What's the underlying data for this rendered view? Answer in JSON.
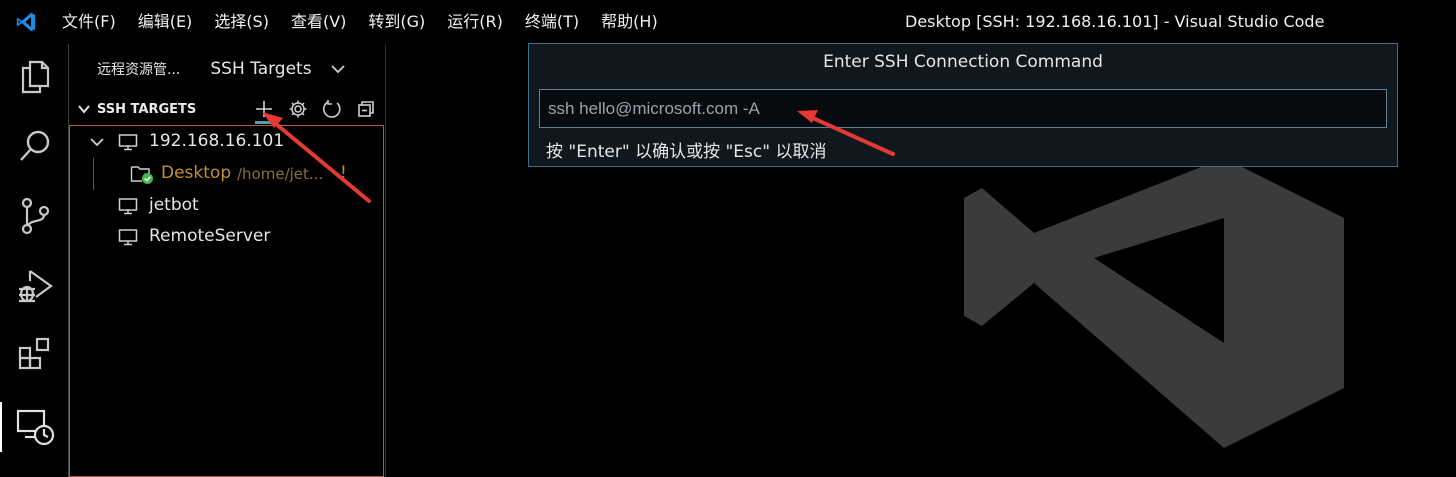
{
  "menu": [
    "文件(F)",
    "编辑(E)",
    "选择(S)",
    "查看(V)",
    "转到(G)",
    "运行(R)",
    "终端(T)",
    "帮助(H)"
  ],
  "window_title": "Desktop [SSH: 192.168.16.101] - Visual Studio Code",
  "activity_bar": {
    "icons": [
      "explorer-icon",
      "search-icon",
      "source-control-icon",
      "run-debug-icon",
      "extensions-icon",
      "remote-explorer-icon"
    ],
    "active": "remote-explorer-icon"
  },
  "sidebar": {
    "title": "远程资源管...",
    "dropdown_value": "SSH Targets",
    "section_title": "SSH TARGETS",
    "section_actions": [
      "add-icon",
      "gear-icon",
      "refresh-icon",
      "collapse-all-icon"
    ],
    "tree": {
      "host_expanded": "192.168.16.101",
      "folder_label": "Desktop",
      "folder_path": "/home/jet...",
      "folder_marker": "!",
      "hosts": [
        "jetbot",
        "RemoteServer"
      ]
    }
  },
  "quick_input": {
    "title": "Enter SSH Connection Command",
    "value": "ssh hello@microsoft.com -A",
    "message": "按 \"Enter\" 以确认或按 \"Esc\" 以取消"
  },
  "colors": {
    "accent": "#4fa0a8",
    "annotation_arrow": "#e53935",
    "folder_connected": "#c09030",
    "status_ok": "#3fb950"
  }
}
